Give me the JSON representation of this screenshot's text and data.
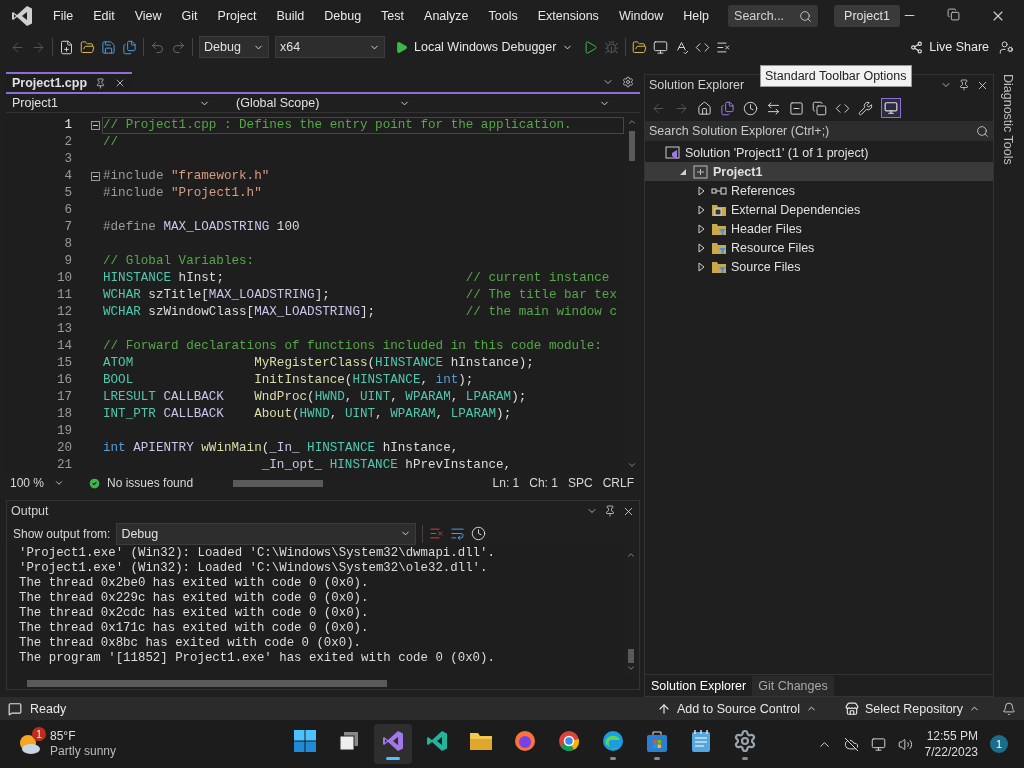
{
  "menu_bar": {
    "items": [
      "File",
      "Edit",
      "View",
      "Git",
      "Project",
      "Build",
      "Debug",
      "Test",
      "Analyze",
      "Tools",
      "Extensions",
      "Window",
      "Help"
    ],
    "search": {
      "placeholder": "Search..."
    },
    "solution_name": "Project1"
  },
  "toolbar": {
    "configuration": "Debug",
    "platform": "x64",
    "debugger": "Local Windows Debugger",
    "live_share": "Live Share"
  },
  "tooltip": "Standard Toolbar Options",
  "editor": {
    "tab": {
      "title": "Project1.cpp",
      "selected": true
    },
    "nav": {
      "project": "Project1",
      "scope": "(Global Scope)"
    },
    "lines": [
      {
        "number": "1",
        "fold": true,
        "current": true,
        "tokens": [
          {
            "kind": "comment",
            "text": "// Project1.cpp : Defines the entry point for the application."
          }
        ]
      },
      {
        "number": "2",
        "fold": false,
        "current": false,
        "tokens": [
          {
            "kind": "comment",
            "text": "//"
          }
        ]
      },
      {
        "number": "3",
        "fold": false,
        "current": false
      },
      {
        "number": "4",
        "fold": true,
        "current": false,
        "tokens": [
          {
            "kind": "preproc",
            "text": "#include "
          },
          {
            "kind": "string",
            "text": "\"framework.h\""
          }
        ]
      },
      {
        "number": "5",
        "fold": false,
        "current": false,
        "tokens": [
          {
            "kind": "preproc",
            "text": "#include "
          },
          {
            "kind": "string",
            "text": "\"Project1.h\""
          }
        ]
      },
      {
        "number": "6",
        "fold": false,
        "current": false
      },
      {
        "number": "7",
        "fold": false,
        "current": false,
        "tokens": [
          {
            "kind": "preproc",
            "text": "#define "
          },
          {
            "kind": "macro",
            "text": "MAX_LOADSTRING"
          },
          {
            "kind": "plain",
            "text": " 100"
          }
        ]
      },
      {
        "number": "8",
        "fold": false,
        "current": false
      },
      {
        "number": "9",
        "fold": false,
        "current": false,
        "tokens": [
          {
            "kind": "comment",
            "text": "// Global Variables:"
          }
        ]
      },
      {
        "number": "10",
        "fold": false,
        "current": false,
        "tokens": [
          {
            "kind": "type",
            "text": "HINSTANCE"
          },
          {
            "kind": "plain",
            "text": " hInst;                                "
          },
          {
            "kind": "comment",
            "text": "// current instance"
          }
        ]
      },
      {
        "number": "11",
        "fold": false,
        "current": false,
        "tokens": [
          {
            "kind": "type",
            "text": "WCHAR"
          },
          {
            "kind": "plain",
            "text": " szTitle["
          },
          {
            "kind": "macro",
            "text": "MAX_LOADSTRING"
          },
          {
            "kind": "plain",
            "text": "];                  "
          },
          {
            "kind": "comment",
            "text": "// The title bar tex"
          }
        ]
      },
      {
        "number": "12",
        "fold": false,
        "current": false,
        "tokens": [
          {
            "kind": "type",
            "text": "WCHAR"
          },
          {
            "kind": "plain",
            "text": " szWindowClass["
          },
          {
            "kind": "macro",
            "text": "MAX_LOADSTRING"
          },
          {
            "kind": "plain",
            "text": "];            "
          },
          {
            "kind": "comment",
            "text": "// the main window c"
          }
        ]
      },
      {
        "number": "13",
        "fold": false,
        "current": false
      },
      {
        "number": "14",
        "fold": false,
        "current": false,
        "tokens": [
          {
            "kind": "comment",
            "text": "// Forward declarations of functions included in this code module:"
          }
        ]
      },
      {
        "number": "15",
        "fold": false,
        "current": false,
        "tokens": [
          {
            "kind": "type",
            "text": "ATOM                "
          },
          {
            "kind": "func",
            "text": "MyRegisterClass"
          },
          {
            "kind": "plain",
            "text": "("
          },
          {
            "kind": "type",
            "text": "HINSTANCE"
          },
          {
            "kind": "plain",
            "text": " hInstance);"
          }
        ]
      },
      {
        "number": "16",
        "fold": false,
        "current": false,
        "tokens": [
          {
            "kind": "type",
            "text": "BOOL                "
          },
          {
            "kind": "func",
            "text": "InitInstance"
          },
          {
            "kind": "plain",
            "text": "("
          },
          {
            "kind": "type",
            "text": "HINSTANCE"
          },
          {
            "kind": "plain",
            "text": ", "
          },
          {
            "kind": "keyword",
            "text": "int"
          },
          {
            "kind": "plain",
            "text": ");"
          }
        ]
      },
      {
        "number": "17",
        "fold": false,
        "current": false,
        "tokens": [
          {
            "kind": "type",
            "text": "LRESULT"
          },
          {
            "kind": "macro",
            "text": " CALLBACK    "
          },
          {
            "kind": "func",
            "text": "WndProc"
          },
          {
            "kind": "plain",
            "text": "("
          },
          {
            "kind": "type",
            "text": "HWND"
          },
          {
            "kind": "plain",
            "text": ", "
          },
          {
            "kind": "type",
            "text": "UINT"
          },
          {
            "kind": "plain",
            "text": ", "
          },
          {
            "kind": "type",
            "text": "WPARAM"
          },
          {
            "kind": "plain",
            "text": ", "
          },
          {
            "kind": "type",
            "text": "LPARAM"
          },
          {
            "kind": "plain",
            "text": ");"
          }
        ]
      },
      {
        "number": "18",
        "fold": false,
        "current": false,
        "tokens": [
          {
            "kind": "type",
            "text": "INT_PTR"
          },
          {
            "kind": "macro",
            "text": " CALLBACK    "
          },
          {
            "kind": "func",
            "text": "About"
          },
          {
            "kind": "plain",
            "text": "("
          },
          {
            "kind": "type",
            "text": "HWND"
          },
          {
            "kind": "plain",
            "text": ", "
          },
          {
            "kind": "type",
            "text": "UINT"
          },
          {
            "kind": "plain",
            "text": ", "
          },
          {
            "kind": "type",
            "text": "WPARAM"
          },
          {
            "kind": "plain",
            "text": ", "
          },
          {
            "kind": "type",
            "text": "LPARAM"
          },
          {
            "kind": "plain",
            "text": ");"
          }
        ]
      },
      {
        "number": "19",
        "fold": false,
        "current": false
      },
      {
        "number": "20",
        "fold": false,
        "current": false,
        "tokens": [
          {
            "kind": "keyword",
            "text": "int"
          },
          {
            "kind": "macro",
            "text": " APIENTRY "
          },
          {
            "kind": "func",
            "text": "wWinMain"
          },
          {
            "kind": "plain",
            "text": "("
          },
          {
            "kind": "macro",
            "text": "_In_ "
          },
          {
            "kind": "type",
            "text": "HINSTANCE"
          },
          {
            "kind": "plain",
            "text": " hInstance,"
          }
        ]
      },
      {
        "number": "21",
        "fold": false,
        "current": false,
        "tokens": [
          {
            "kind": "macro",
            "text": "                     _In_opt_ "
          },
          {
            "kind": "type",
            "text": "HINSTANCE"
          },
          {
            "kind": "plain",
            "text": " hPrevInstance,"
          }
        ]
      }
    ],
    "status": {
      "zoom": "100 %",
      "issues": "No issues found",
      "line": "Ln: 1",
      "char": "Ch: 1",
      "whitespace": "SPC",
      "line_ending": "CRLF"
    }
  },
  "output": {
    "title": "Output",
    "source_label": "Show output from:",
    "source": "Debug",
    "lines": [
      "'Project1.exe' (Win32): Loaded 'C:\\Windows\\System32\\dwmapi.dll'.",
      "'Project1.exe' (Win32): Loaded 'C:\\Windows\\System32\\ole32.dll'.",
      "The thread 0x2be0 has exited with code 0 (0x0).",
      "The thread 0x229c has exited with code 0 (0x0).",
      "The thread 0x2cdc has exited with code 0 (0x0).",
      "The thread 0x171c has exited with code 0 (0x0).",
      "The thread 0x8bc has exited with code 0 (0x0).",
      "The program '[11852] Project1.exe' has exited with code 0 (0x0)."
    ]
  },
  "solution_explorer": {
    "title": "Solution Explorer",
    "search": {
      "placeholder": "Search Solution Explorer (Ctrl+;)"
    },
    "tree": [
      {
        "label": "Solution 'Project1' (1 of 1 project)",
        "kind": "solution",
        "selected": false,
        "children": [
          {
            "label": "Project1",
            "kind": "project",
            "expanded": true,
            "selected": true,
            "children": [
              {
                "label": "References",
                "kind": "references",
                "expanded": false,
                "selected": false
              },
              {
                "label": "External Dependencies",
                "kind": "dependencies",
                "expanded": false,
                "selected": false
              },
              {
                "label": "Header Files",
                "kind": "filter",
                "expanded": false,
                "selected": false
              },
              {
                "label": "Resource Files",
                "kind": "filter",
                "expanded": false,
                "selected": false
              },
              {
                "label": "Source Files",
                "kind": "filter",
                "expanded": false,
                "selected": false
              }
            ]
          }
        ]
      }
    ],
    "tabs": [
      {
        "label": "Solution Explorer",
        "selected": true
      },
      {
        "label": "Git Changes",
        "selected": false
      }
    ]
  },
  "side_tab": "Diagnostic Tools",
  "status_bar": {
    "status": "Ready",
    "source_control": "Add to Source Control",
    "repository": "Select Repository"
  },
  "taskbar": {
    "weather": {
      "badge": "1",
      "temperature": "85°F",
      "condition": "Partly sunny"
    },
    "apps": [
      {
        "kind": "start",
        "running": false,
        "selected": false
      },
      {
        "kind": "taskview",
        "running": false,
        "selected": false
      },
      {
        "kind": "vs",
        "running": true,
        "selected": true
      },
      {
        "kind": "vscode",
        "running": false,
        "selected": false
      },
      {
        "kind": "explorer",
        "running": false,
        "selected": false
      },
      {
        "kind": "firefox",
        "running": false,
        "selected": false
      },
      {
        "kind": "chrome",
        "running": false,
        "selected": false
      },
      {
        "kind": "edge",
        "running": true,
        "selected": false
      },
      {
        "kind": "store",
        "running": true,
        "selected": false
      },
      {
        "kind": "notepad",
        "running": false,
        "selected": false
      },
      {
        "kind": "settings",
        "running": true,
        "selected": false
      }
    ],
    "time": "12:55 PM",
    "date": "7/22/2023",
    "notifications": "1"
  }
}
